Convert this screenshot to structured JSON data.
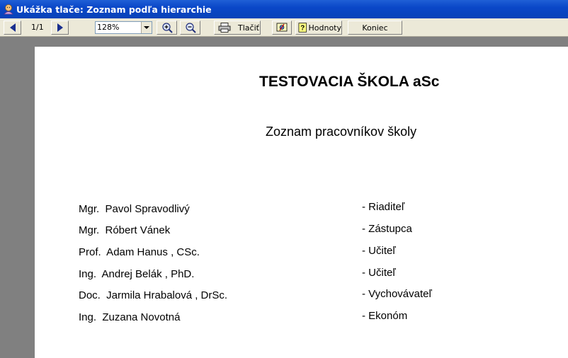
{
  "window": {
    "title": "Ukážka tlače: Zoznam podľa hierarchie"
  },
  "toolbar": {
    "page_indicator": "1/1",
    "zoom_value": "128%",
    "print_label": "Tlačiť",
    "values_label": "Hodnoty",
    "close_label": "Koniec"
  },
  "document": {
    "school_name": "TESTOVACIA ŠKOLA aSc",
    "heading": "Zoznam pracovníkov školy",
    "staff": [
      {
        "name": "Mgr.  Pavol Spravodlivý",
        "role": "- Riaditeľ"
      },
      {
        "name": "Mgr.  Róbert Vánek",
        "role": "- Zástupca"
      },
      {
        "name": "Prof.  Adam Hanus , CSc.",
        "role": "- Učiteľ"
      },
      {
        "name": "Ing.  Andrej Belák , PhD.",
        "role": "- Učiteľ"
      },
      {
        "name": "Doc.  Jarmila Hrabalová , DrSc.",
        "role": "- Vychovávateľ"
      },
      {
        "name": "Ing.  Zuzana Novotná",
        "role": "- Ekonóm"
      }
    ]
  },
  "icons": {
    "app": "app-icon",
    "prev": "arrow-left-icon",
    "next": "arrow-right-icon",
    "zoom_in": "zoom-in-icon",
    "zoom_out": "zoom-out-icon",
    "print": "printer-icon",
    "setup": "setup-icon",
    "values": "help-icon"
  }
}
